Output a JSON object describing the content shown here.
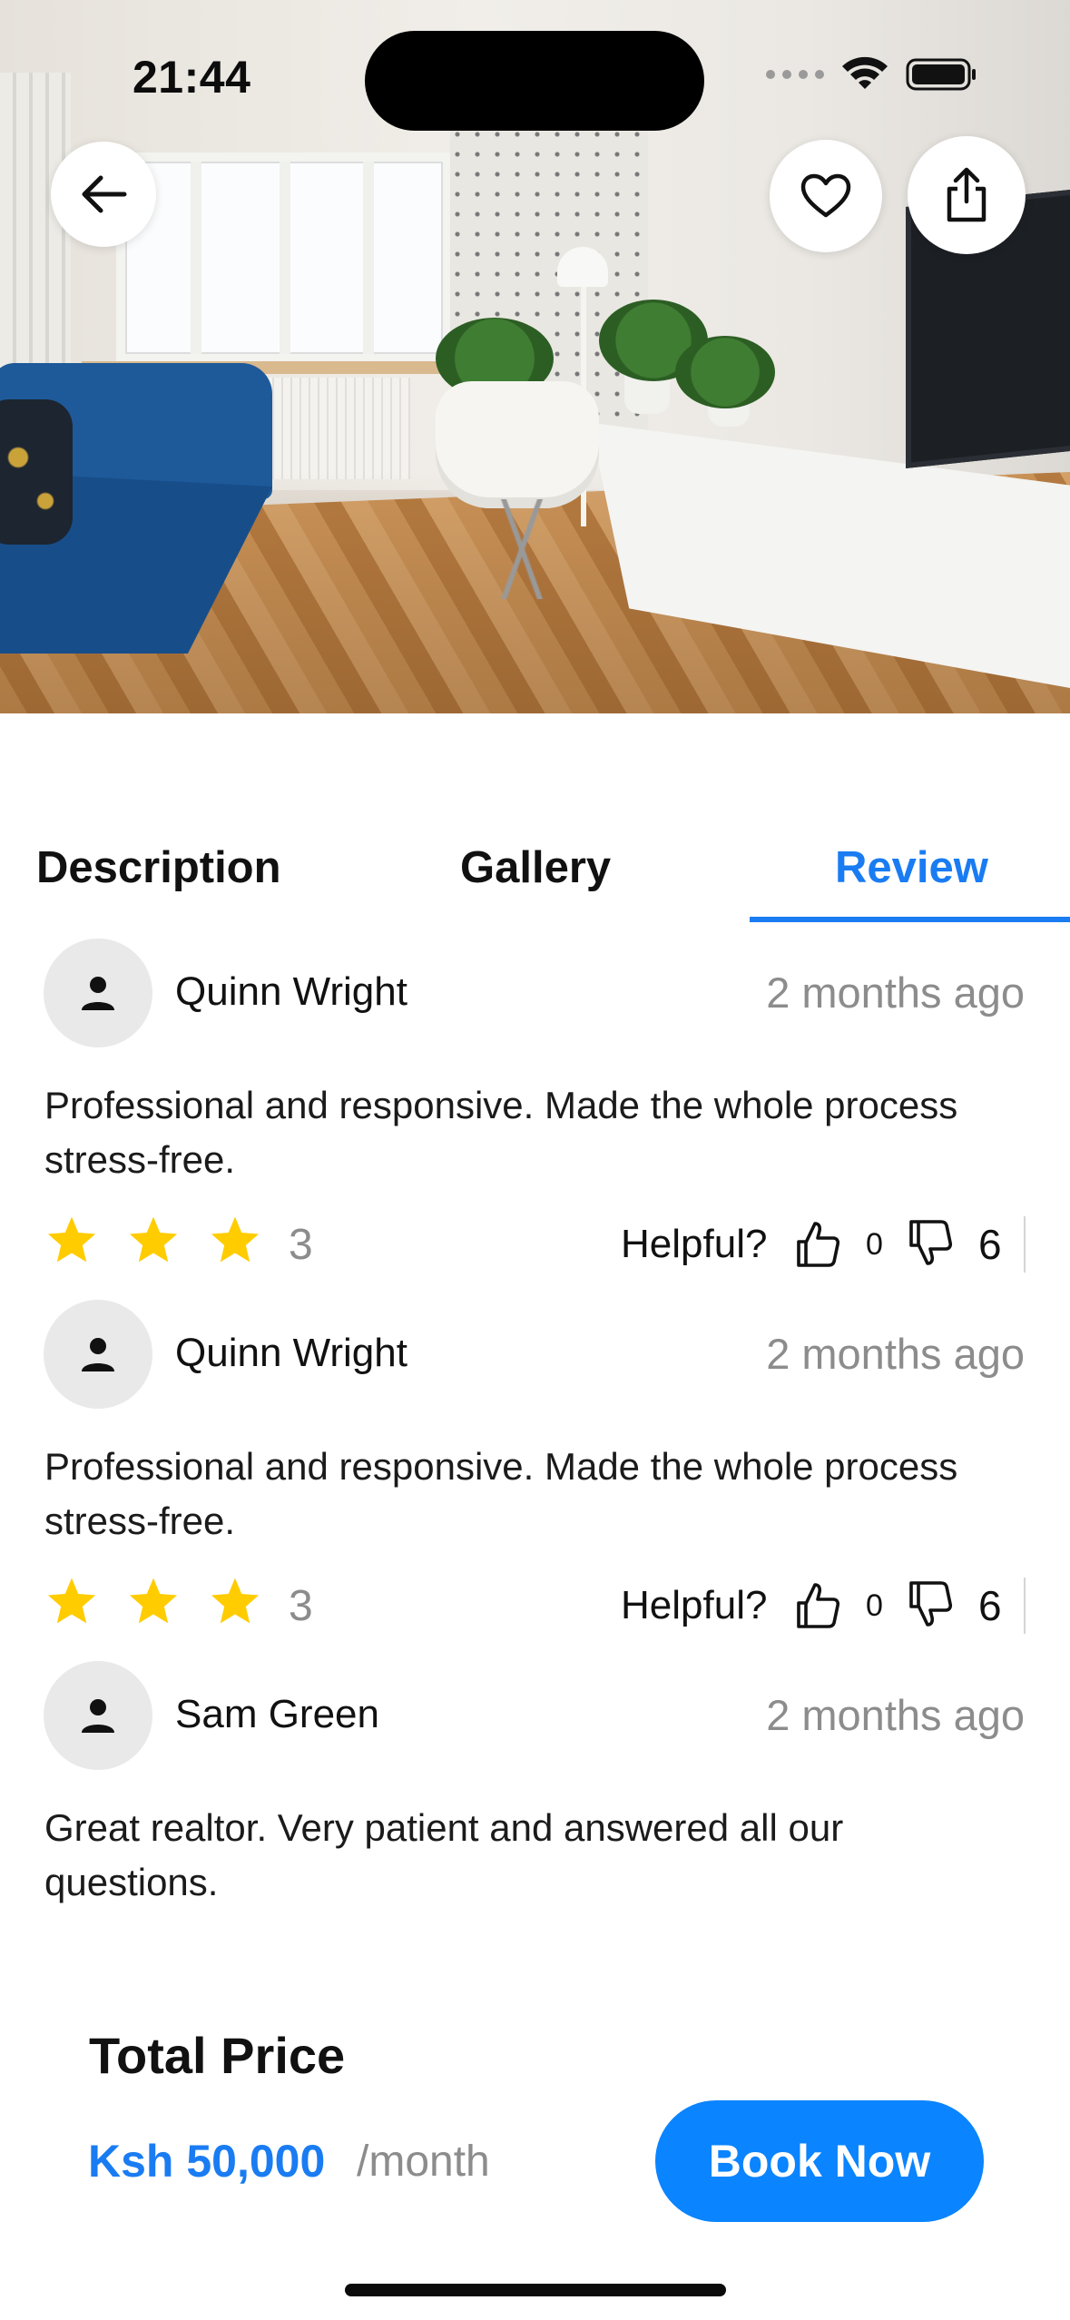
{
  "status_bar": {
    "time": "21:44"
  },
  "hero": {
    "back_icon": "arrow-left-icon",
    "favorite_icon": "heart-icon",
    "share_icon": "share-icon"
  },
  "tabs": [
    {
      "label": "Description",
      "active": false
    },
    {
      "label": "Gallery",
      "active": false
    },
    {
      "label": "Review",
      "active": true
    }
  ],
  "reviews": [
    {
      "name": "Quinn Wright",
      "time": "2 months ago",
      "text": "Professional and responsive. Made the whole process stress-free.",
      "stars": 3,
      "rating_label": "3",
      "helpful_label": "Helpful?",
      "up_count": "0",
      "down_count": "6"
    },
    {
      "name": "Quinn Wright",
      "time": "2 months ago",
      "text": "Professional and responsive. Made the whole process stress-free.",
      "stars": 3,
      "rating_label": "3",
      "helpful_label": "Helpful?",
      "up_count": "0",
      "down_count": "6"
    },
    {
      "name": "Sam Green",
      "time": "2 months ago",
      "text": "Great realtor. Very patient and answered all our questions."
    }
  ],
  "pricing": {
    "total_label": "Total Price",
    "price": "Ksh 50,000",
    "period": "/month",
    "book_label": "Book Now"
  },
  "colors": {
    "accent": "#0a84ff",
    "star": "#ffcc00",
    "muted": "#8c8c8c"
  }
}
